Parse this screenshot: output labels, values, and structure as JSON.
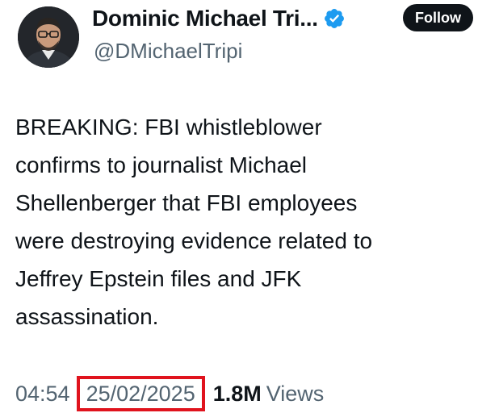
{
  "author": {
    "display_name": "Dominic Michael Tri...",
    "handle": "@DMichaelTripi",
    "verified_icon": "verified-badge-icon"
  },
  "actions": {
    "follow_label": "Follow"
  },
  "tweet": {
    "lines": [
      "BREAKING: FBI whistleblower",
      "confirms to journalist Michael",
      "Shellenberger that FBI employees",
      "were destroying evidence related to",
      "Jeffrey Epstein files and JFK",
      "assassination."
    ]
  },
  "meta": {
    "time": "04:54",
    "date": "25/02/2025",
    "views_count": "1.8M",
    "views_label": "Views"
  },
  "colors": {
    "verified_blue": "#1d9bf0",
    "highlight_red": "#e0131d",
    "secondary_text": "#536471",
    "primary_text": "#0f1419"
  }
}
